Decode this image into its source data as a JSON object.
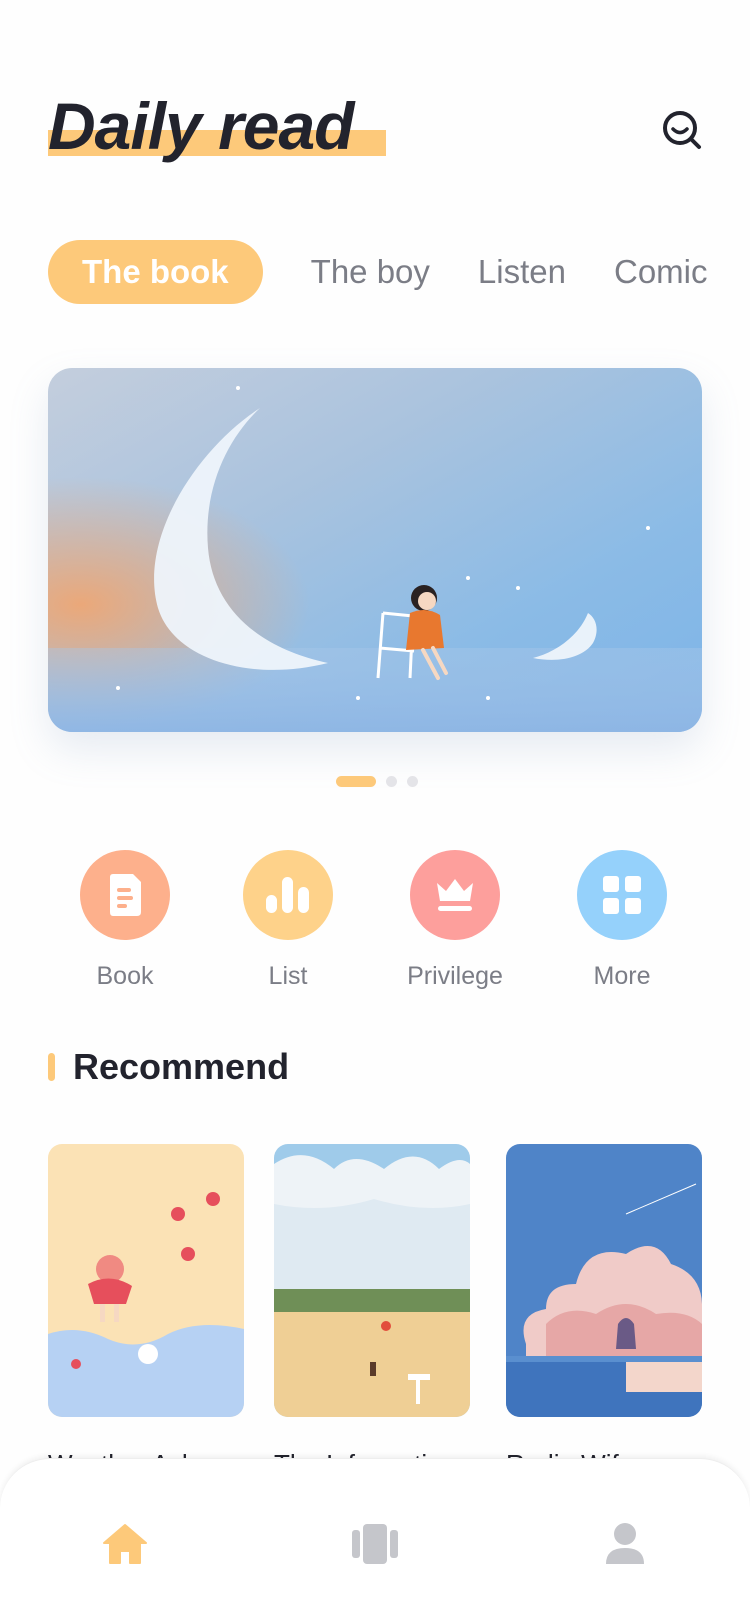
{
  "app": {
    "title": "Daily read",
    "accent": "#fdc97a"
  },
  "header": {
    "search_icon": "search-icon"
  },
  "tabs": [
    {
      "label": "The book",
      "active": true
    },
    {
      "label": "The boy",
      "active": false
    },
    {
      "label": "Listen",
      "active": false
    },
    {
      "label": "Comic",
      "active": false
    }
  ],
  "banner": {
    "slides_total": 3,
    "current_slide": 1
  },
  "actions": [
    {
      "label": "Book",
      "icon": "book-icon",
      "color": "#fdb08c"
    },
    {
      "label": "List",
      "icon": "list-chart-icon",
      "color": "#fed28a"
    },
    {
      "label": "Privilege",
      "icon": "crown-icon",
      "color": "#fd9f9c"
    },
    {
      "label": "More",
      "icon": "grid-icon",
      "color": "#95d1fb"
    }
  ],
  "recommend": {
    "title": "Recommend",
    "books": [
      {
        "name": "Weather Achan"
      },
      {
        "name": "The Information"
      },
      {
        "name": "Radio Wife"
      }
    ]
  },
  "bottom_nav": [
    {
      "icon": "home-icon",
      "active": true,
      "color": "#fdc97a"
    },
    {
      "icon": "cards-icon",
      "active": false,
      "color": "#c5c6cb"
    },
    {
      "icon": "user-icon",
      "active": false,
      "color": "#c5c6cb"
    }
  ]
}
